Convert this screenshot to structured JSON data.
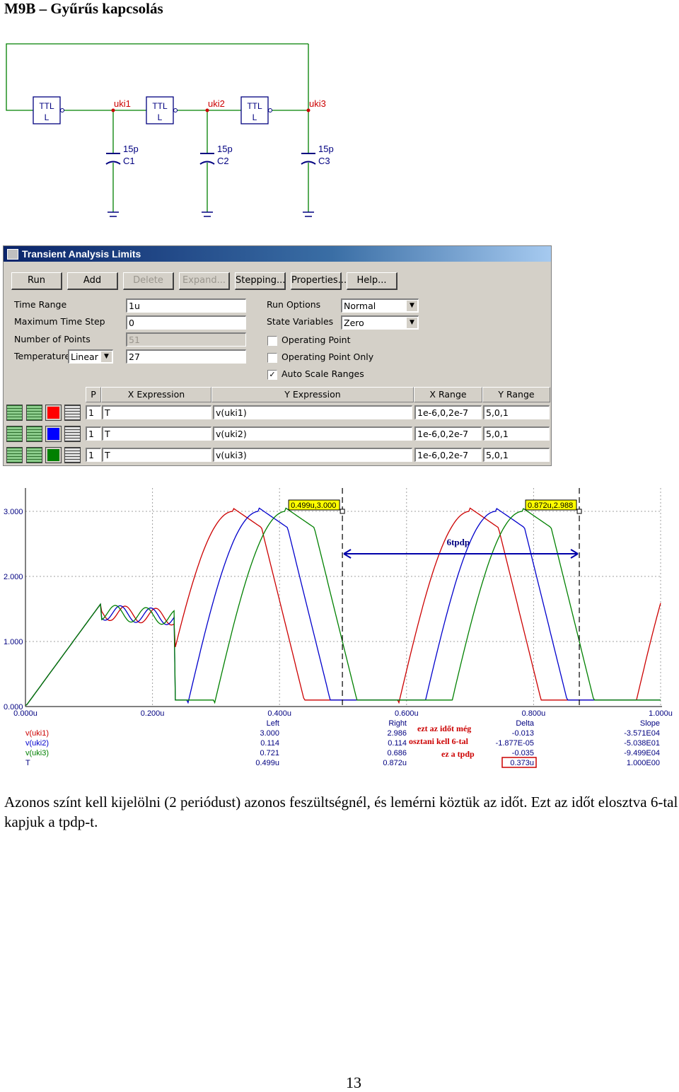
{
  "page_title": "M9B – Gyűrűs kapcsolás",
  "schematic": {
    "gates": [
      {
        "line1": "TTL",
        "line2": "L"
      },
      {
        "line1": "TTL",
        "line2": "L"
      },
      {
        "line1": "TTL",
        "line2": "L"
      }
    ],
    "nodes": [
      "uki1",
      "uki2",
      "uki3"
    ],
    "capacitors": [
      {
        "value": "15p",
        "name": "C1"
      },
      {
        "value": "15p",
        "name": "C2"
      },
      {
        "value": "15p",
        "name": "C3"
      }
    ],
    "wire_color": "#008000",
    "node_label_color": "#cc0000",
    "component_color": "#000080"
  },
  "dialog": {
    "title": "Transient Analysis Limits",
    "buttons": [
      {
        "label": "Run",
        "enabled": true
      },
      {
        "label": "Add",
        "enabled": true
      },
      {
        "label": "Delete",
        "enabled": false
      },
      {
        "label": "Expand...",
        "enabled": false
      },
      {
        "label": "Stepping...",
        "enabled": true
      },
      {
        "label": "Properties...",
        "enabled": true
      },
      {
        "label": "Help...",
        "enabled": true
      }
    ],
    "fields": {
      "time_range_label": "Time Range",
      "time_range_value": "1u",
      "max_step_label": "Maximum Time Step",
      "max_step_value": "0",
      "num_points_label": "Number of Points",
      "num_points_value": "51",
      "temperature_label": "Temperature",
      "temperature_mode": "Linear",
      "temperature_value": "27",
      "run_options_label": "Run Options",
      "run_options_value": "Normal",
      "state_variables_label": "State Variables",
      "state_variables_value": "Zero"
    },
    "checkboxes": [
      {
        "label": "Operating Point",
        "checked": false
      },
      {
        "label": "Operating Point Only",
        "checked": false
      },
      {
        "label": "Auto Scale Ranges",
        "checked": true
      }
    ],
    "table_headers": [
      "P",
      "X Expression",
      "Y Expression",
      "X Range",
      "Y Range"
    ],
    "rows": [
      {
        "color": "#ff0000",
        "p": "1",
        "x": "T",
        "y": "v(uki1)",
        "xrange": "1e-6,0,2e-7",
        "yrange": "5,0,1"
      },
      {
        "color": "#0000ff",
        "p": "1",
        "x": "T",
        "y": "v(uki2)",
        "xrange": "1e-6,0,2e-7",
        "yrange": "5,0,1"
      },
      {
        "color": "#008000",
        "p": "1",
        "x": "T",
        "y": "v(uki3)",
        "xrange": "1e-6,0,2e-7",
        "yrange": "5,0,1"
      }
    ]
  },
  "chart_data": {
    "type": "line",
    "x_unit": "s",
    "xlim": [
      0,
      1.0
    ],
    "ylim": [
      0,
      3.2
    ],
    "x_ticks": [
      "0.000u",
      "0.200u",
      "0.400u",
      "0.600u",
      "0.800u",
      "1.000u"
    ],
    "y_ticks": [
      "0.000",
      "1.000",
      "2.000",
      "3.000"
    ],
    "grid": true,
    "period_us": 0.373,
    "series": [
      {
        "name": "v(uki1)",
        "color": "#cc0000",
        "start_us": 0.235,
        "phase_us": 0.0
      },
      {
        "name": "v(uki2)",
        "color": "#0000cc",
        "start_us": 0.235,
        "phase_us": 0.041
      },
      {
        "name": "v(uki3)",
        "color": "#008000",
        "start_us": 0.235,
        "phase_us": 0.083
      }
    ],
    "cursor_left": {
      "x": 0.499,
      "label": "0.499u,3.000"
    },
    "cursor_right": {
      "x": 0.872,
      "label": "0.872u,2.988"
    },
    "arrow_label": "6tpdp",
    "readout": {
      "headers": [
        "Left",
        "Right",
        "Delta",
        "Slope"
      ],
      "rows": [
        {
          "name": "v(uki1)",
          "left": "3.000",
          "right": "2.986",
          "delta": "-0.013",
          "slope": "-3.571E04",
          "color": "#cc0000"
        },
        {
          "name": "v(uki2)",
          "left": "0.114",
          "right": "0.114",
          "delta": "-1.877E-05",
          "slope": "-5.038E01",
          "color": "#0000cc"
        },
        {
          "name": "v(uki3)",
          "left": "0.721",
          "right": "0.686",
          "delta": "-0.035",
          "slope": "-9.499E04",
          "color": "#008000"
        },
        {
          "name": "T",
          "left": "0.499u",
          "right": "0.872u",
          "delta": "0.373u",
          "slope": "1.000E00",
          "color": "#000080"
        }
      ],
      "annotation_lines": [
        "ezt az időt még",
        "osztani kell 6-tal",
        "ez a tpdp"
      ]
    }
  },
  "body_text": "Azonos színt kell kijelölni (2 periódust) azonos feszültségnél, és lemérni köztük az időt. Ezt az időt elosztva 6-tal kapjuk a tpdp-t.",
  "page_number": "13"
}
